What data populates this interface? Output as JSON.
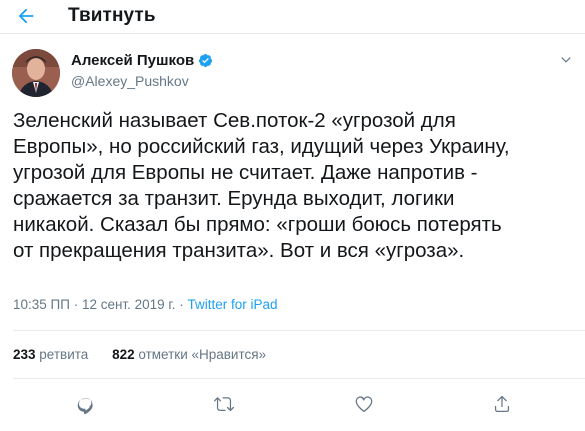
{
  "header": {
    "title": "Твитнуть",
    "back_icon": "arrow-left-icon",
    "accent": "#1da1f2"
  },
  "author": {
    "name": "Алексей Пушков",
    "handle": "@Alexey_Pushkov",
    "verified_icon": "verified-badge-icon",
    "menu_icon": "chevron-down-icon"
  },
  "tweet": {
    "lines": [
      "Зеленский называет Сев.поток-2 «угрозой для",
      "Европы», но российский газ, идущий через Украину,",
      "угрозой для Европы не считает. Даже напротив -",
      "сражается за транзит. Ерунда выходит, логики",
      "никакой. Сказал бы прямо: «гроши боюсь потерять",
      "от прекращения транзита». Вот и вся «угроза»."
    ]
  },
  "meta": {
    "time": "10:35 ПП",
    "separator": " · ",
    "date": "12 сент. 2019 г.",
    "source": "Twitter for iPad"
  },
  "stats": {
    "retweets_count": "233",
    "retweets_label": "ретвита",
    "likes_count": "822",
    "likes_label": "отметки «Нравится»"
  },
  "actions": {
    "reply_icon": "reply-icon",
    "retweet_icon": "retweet-icon",
    "like_icon": "heart-icon",
    "share_icon": "share-icon",
    "icon_color": "#657786"
  }
}
